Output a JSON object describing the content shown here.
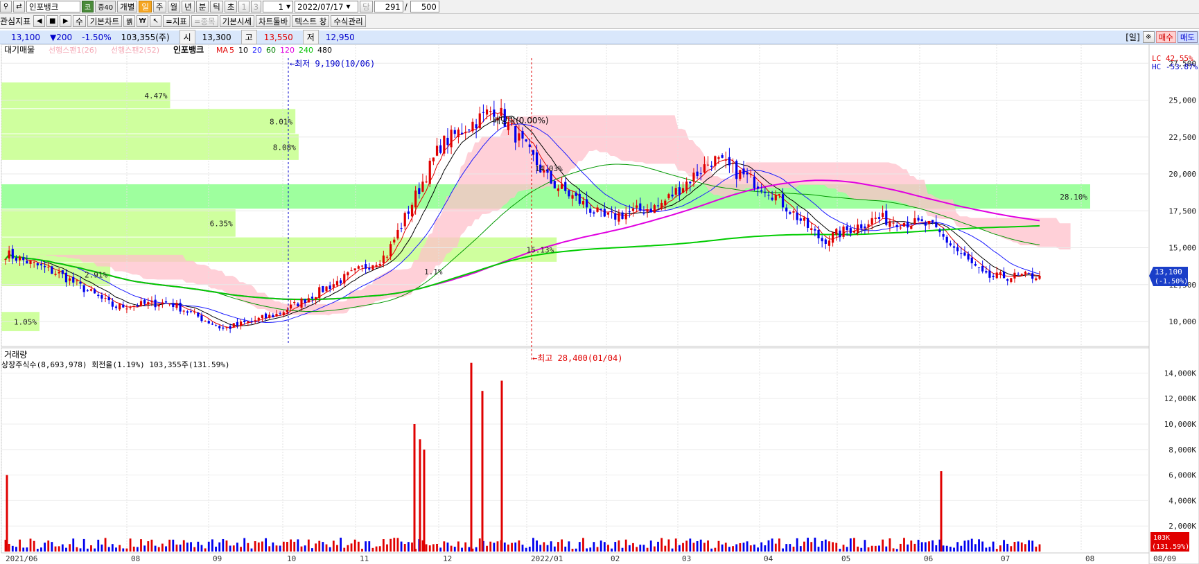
{
  "toolbar1": {
    "stock_name": "인포뱅크",
    "market_badge": "코",
    "margin_badge": "증40",
    "individual_label": "개별",
    "periods": [
      "일",
      "주",
      "월",
      "년",
      "분",
      "틱",
      "초"
    ],
    "selected_period": "일",
    "unit_a": "1",
    "unit_b": "3",
    "count_value": "1",
    "date_value": "2022/07/17",
    "dang_label": "당",
    "view_count": "291",
    "slash": "/",
    "total_count": "500"
  },
  "toolbar2": {
    "items": [
      "관심지표",
      "◀",
      "■",
      "▶",
      "수",
      "기본차트",
      "꿹",
      "₩",
      "↖",
      "=지표",
      "=종목",
      "기본시세",
      "차트툴바",
      "텍스트 창",
      "수식관리"
    ]
  },
  "info_bar": {
    "price": "13,100",
    "change": "▼200",
    "change_rate": "-1.50%",
    "volume": "103,355(주)",
    "open_label": "시",
    "open": "13,300",
    "high_label": "고",
    "high": "13,550",
    "low_label": "저",
    "low": "12,950",
    "period_label": "[일]",
    "buy_label": "매수",
    "sell_label": "매도"
  },
  "price_pane": {
    "legend_left": "대기매물",
    "legend_span1": "선행스팬1(26)",
    "legend_span2": "선행스팬2(52)",
    "legend_stock": "인포뱅크",
    "ma_label": "MA",
    "ma_periods": [
      {
        "label": "5",
        "color": "#e00000"
      },
      {
        "label": "10",
        "color": "#000000"
      },
      {
        "label": "20",
        "color": "#1a1aff"
      },
      {
        "label": "60",
        "color": "#008000"
      },
      {
        "label": "120",
        "color": "#e000e0"
      },
      {
        "label": "240",
        "color": "#00c000"
      },
      {
        "label": "480",
        "color": "#000000"
      }
    ],
    "lc_label": "LC  42.55%",
    "hc_label": "HC -53.87%",
    "low_annot": "←최저 9,190(10/06)",
    "high_annot": "←최고 28,400(01/04)",
    "dividend_annot": "배당락(0.00%)",
    "last_price_tag": "13,100",
    "last_change_tag": "(-1.50%)",
    "y_ticks": [
      "27,500",
      "25,000",
      "22,500",
      "20,000",
      "17,500",
      "15,000",
      "12,500",
      "10,000"
    ],
    "y_tick_values": [
      27500,
      25000,
      22500,
      20000,
      17500,
      15000,
      12500,
      10000
    ],
    "supply_zones": [
      {
        "label": "4.47%",
        "price_low": 24400,
        "price_high": 26200,
        "length": 0.155
      },
      {
        "label": "8.01%",
        "price_low": 22700,
        "price_high": 24400,
        "length": 0.27
      },
      {
        "label": "8.08%",
        "price_low": 20900,
        "price_high": 22700,
        "length": 0.273
      },
      {
        "label": "28.10%",
        "price_low": 17600,
        "price_high": 19300,
        "length": 1.0
      },
      {
        "label": "6.35%",
        "price_low": 15700,
        "price_high": 17600,
        "length": 0.215
      },
      {
        "label": "15.13%",
        "price_low": 14000,
        "price_high": 15700,
        "length": 0.51
      },
      {
        "label": "2.91%",
        "price_low": 12350,
        "price_high": 14000,
        "length": 0.1
      },
      {
        "label": "1.05%",
        "price_low": 9300,
        "price_high": 10650,
        "length": 0.035
      }
    ],
    "inner_labels": [
      "14.03%",
      "1.1%"
    ]
  },
  "volume_pane": {
    "title": "거래량",
    "sub": "상장주식수(8,693,978) 회전율(1.19%) 103,355주(131.59%)",
    "y_ticks": [
      "14,000K",
      "12,000K",
      "10,000K",
      "8,000K",
      "6,000K",
      "4,000K",
      "2,000K"
    ],
    "y_tick_values": [
      14000,
      12000,
      10000,
      8000,
      6000,
      4000,
      2000
    ],
    "last_volume_tag": "103K",
    "last_volume_pct": "(131.59%)"
  },
  "x_axis": {
    "labels": [
      "2021/06",
      "08",
      "09",
      "10",
      "11",
      "12",
      "2022/01",
      "02",
      "03",
      "04",
      "05",
      "06",
      "07",
      "08",
      "08/09"
    ]
  },
  "chart_data": {
    "type": "candlestick",
    "title": "인포뱅크",
    "start": "2021/06",
    "end": "2022/07",
    "last_close": 13100,
    "period_low": {
      "price": 9190,
      "date": "10/06"
    },
    "period_high": {
      "price": 28400,
      "date": "01/04"
    },
    "ylim": [
      8500,
      28500
    ],
    "close_path": [
      {
        "m": "2021/06",
        "v": 14600
      },
      {
        "m": "2021/07",
        "v": 13200
      },
      {
        "m": "2021/08",
        "v": 11000
      },
      {
        "m": "2021/09",
        "v": 11300
      },
      {
        "m": "2021/10",
        "v": 9500
      },
      {
        "m": "2021/11",
        "v": 10500
      },
      {
        "m": "2021/11 end",
        "v": 12500
      },
      {
        "m": "2021/12",
        "v": 14500
      },
      {
        "m": "2021/12 mid",
        "v": 22000
      },
      {
        "m": "2022/01",
        "v": 24500
      },
      {
        "m": "2022/01 mid",
        "v": 19500
      },
      {
        "m": "2022/02",
        "v": 17000
      },
      {
        "m": "2022/03",
        "v": 17800
      },
      {
        "m": "2022/04",
        "v": 21000
      },
      {
        "m": "2022/04 end",
        "v": 19000
      },
      {
        "m": "2022/05",
        "v": 15500
      },
      {
        "m": "2022/05 end",
        "v": 17000
      },
      {
        "m": "2022/06",
        "v": 16500
      },
      {
        "m": "2022/06 mid",
        "v": 13000
      },
      {
        "m": "2022/07",
        "v": 13100
      }
    ],
    "volume_spikes_k": [
      {
        "m": "2021/06 start",
        "v": 6000
      },
      {
        "m": "2021/12 start",
        "v": 10000
      },
      {
        "m": "2021/12",
        "v": 8800
      },
      {
        "m": "2021/12 mid",
        "v": 8000
      },
      {
        "m": "2021/12 mid2",
        "v": 14800
      },
      {
        "m": "2021/12 mid3",
        "v": 12600
      },
      {
        "m": "2021/12 end",
        "v": 13400
      },
      {
        "m": "2022/06",
        "v": 6300
      }
    ]
  },
  "colors": {
    "up": "#e00000",
    "down": "#0000ee",
    "zone": "#ccff99",
    "zone_hot": "#99ff99",
    "cloud": "#ffc0cb",
    "ma120": "#e000e0",
    "ma240": "#00cc00",
    "ma60": "#009900"
  }
}
